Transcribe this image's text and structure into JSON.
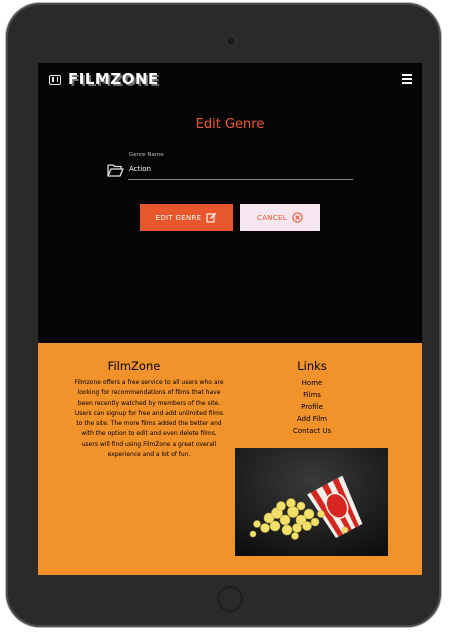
{
  "app": {
    "brand": "FILMZONE"
  },
  "form": {
    "title": "Edit Genre",
    "genre_label": "Genre Name",
    "genre_value": "Action",
    "edit_label": "EDIT GENRE",
    "cancel_label": "CANCEL"
  },
  "footer": {
    "about_title": "FilmZone",
    "about_text": "Filmzone offers a free service to all users who are looking for recommendations of films that have been recently watched by members of the site. Users can signup for free and add unlimited films to the site. The more films added the better and with the option to edit and even delete films, users will find using FilmZone a great overall experience and a lot of fun.",
    "links_title": "Links",
    "links": [
      "Home",
      "Films",
      "Profile",
      "Add Film",
      "Contact Us"
    ]
  },
  "colors": {
    "accent": "#e8562b",
    "title": "#f05a32",
    "footer_bg": "#f1922b",
    "cancel_bg": "#f5e6f0",
    "background": "#060405"
  },
  "icons": [
    "film-icon",
    "hamburger-icon",
    "folder-open-icon",
    "edit-icon",
    "close-circle-icon"
  ]
}
